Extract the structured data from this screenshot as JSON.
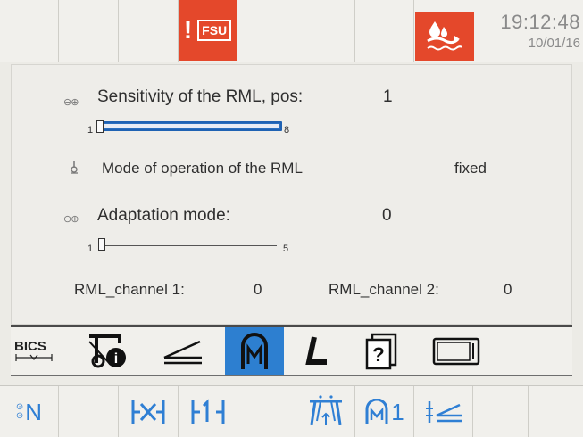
{
  "header": {
    "fsu_label": "FSU",
    "fsu_exclaim": "!",
    "time": "19:12:48",
    "date": "10/01/16",
    "alarm_icon": "water-drop-alarm-icon",
    "accent_red": "#e4482b"
  },
  "panel": {
    "sensitivity": {
      "label": "Sensitivity of the RML, pos:",
      "value": "1",
      "min": "1",
      "max": "8",
      "level": 1,
      "range": [
        1,
        8
      ]
    },
    "mode": {
      "label": "Mode of operation of the RML",
      "value": "fixed"
    },
    "adaptation": {
      "label": "Adaptation mode:",
      "value": "0",
      "min": "1",
      "max": "5",
      "level": 1,
      "range": [
        1,
        5
      ]
    },
    "channel1": {
      "label": "RML_channel 1:",
      "value": "0"
    },
    "channel2": {
      "label": "RML_channel 2:",
      "value": "0"
    }
  },
  "tabs": {
    "bics_label": "BICS",
    "active_index": 3,
    "items": [
      "bics",
      "sewing-machine-info",
      "slope",
      "machine-m",
      "l-shape",
      "help",
      "display"
    ],
    "accent_blue": "#2d7fd0"
  },
  "bottom": {
    "n_label": "N",
    "m1_sub": "1"
  }
}
